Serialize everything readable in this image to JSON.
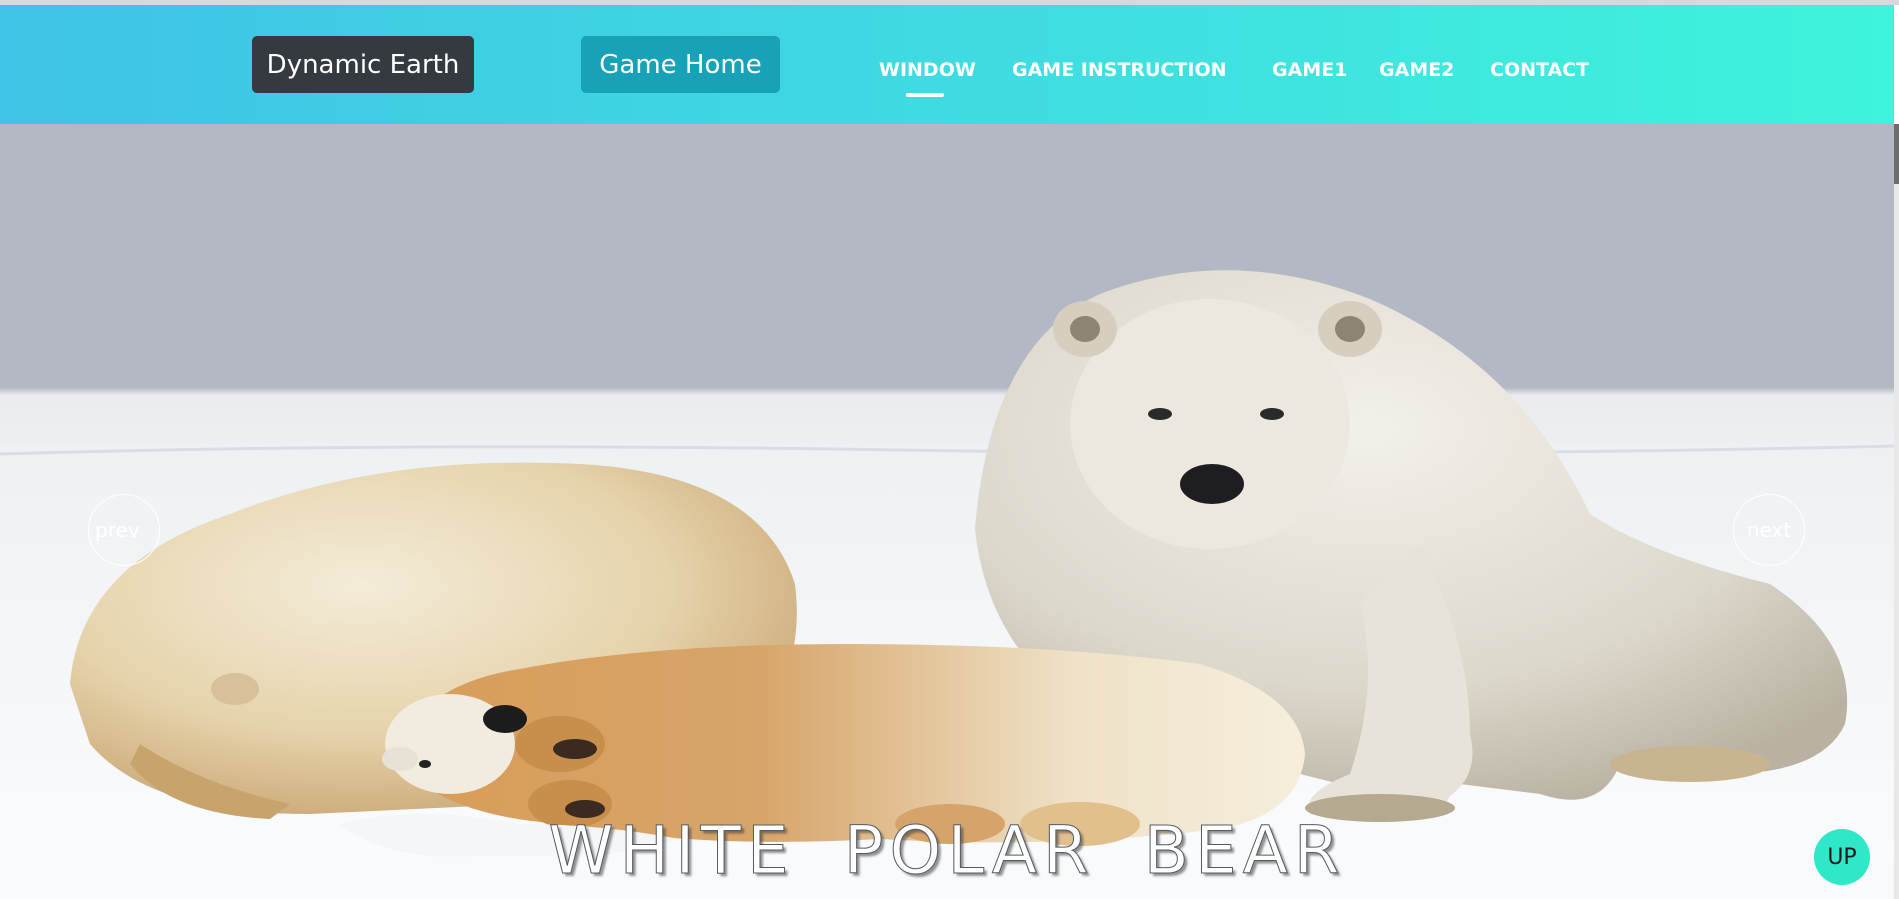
{
  "header": {
    "brand_label": "Dynamic Earth",
    "home_label": "Game Home",
    "nav": [
      {
        "label": "WINDOW",
        "active": true
      },
      {
        "label": "GAME INSTRUCTION",
        "active": false
      },
      {
        "label": "GAME1",
        "active": false
      },
      {
        "label": "GAME2",
        "active": false
      },
      {
        "label": "CONTACT",
        "active": false
      }
    ],
    "gradient_colors": [
      "#3fc3e6",
      "#3ef4dc"
    ]
  },
  "carousel": {
    "prev_label": "prev",
    "next_label": "next",
    "caption": "WHITE POLAR BEAR",
    "image_subject": "polar-bears-on-snow"
  },
  "up_button": {
    "label": "UP",
    "color": "#2ee8c8"
  },
  "colors": {
    "brand_button": "#343a40",
    "home_button": "#17a2b8"
  }
}
